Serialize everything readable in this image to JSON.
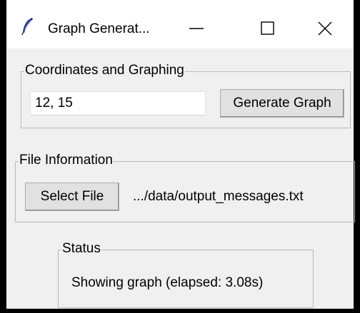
{
  "window": {
    "title": "Graph Generat...",
    "icon": "feather-icon",
    "controls": [
      "minimize-icon",
      "maximize-icon",
      "close-icon"
    ]
  },
  "coordinates": {
    "group_label": "Coordinates and Graphing",
    "input_value": "12, 15",
    "generate_label": "Generate Graph"
  },
  "file": {
    "group_label": "File Information",
    "select_label": "Select File",
    "path": ".../data/output_messages.txt"
  },
  "status": {
    "group_label": "Status",
    "text": "Showing graph (elapsed: 3.08s)"
  }
}
